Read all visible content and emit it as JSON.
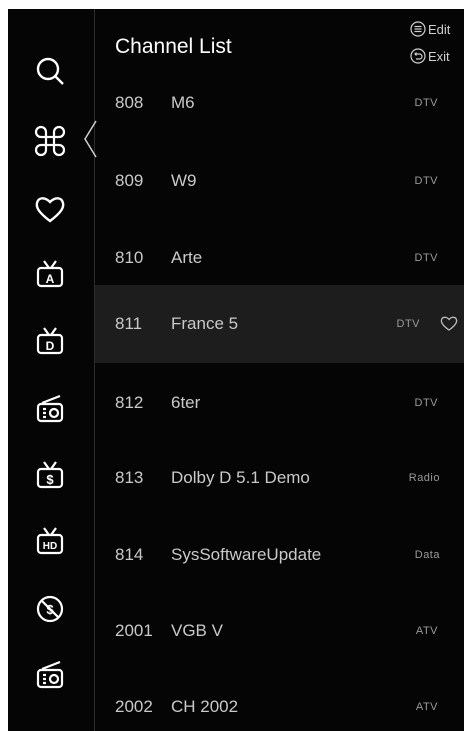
{
  "header": {
    "title": "Channel List",
    "edit_label": "Edit",
    "exit_label": "Exit"
  },
  "sidebar": {
    "items": [
      {
        "icon": "search-icon"
      },
      {
        "icon": "all-channels-icon",
        "active": true
      },
      {
        "icon": "favorites-icon"
      },
      {
        "icon": "tv-antenna-icon"
      },
      {
        "icon": "dtv-icon"
      },
      {
        "icon": "radio-icon"
      },
      {
        "icon": "paid-channel-icon"
      },
      {
        "icon": "hd-channel-icon"
      },
      {
        "icon": "free-channel-icon"
      },
      {
        "icon": "radio-icon"
      }
    ]
  },
  "channels": [
    {
      "number": "808",
      "name": "M6",
      "type": "DTV"
    },
    {
      "number": "809",
      "name": "W9",
      "type": "DTV"
    },
    {
      "number": "810",
      "name": "Arte",
      "type": "DTV"
    },
    {
      "number": "811",
      "name": "France 5",
      "type": "DTV",
      "selected": true,
      "favorite": true
    },
    {
      "number": "812",
      "name": "6ter",
      "type": "DTV"
    },
    {
      "number": "813",
      "name": "Dolby D 5.1 Demo",
      "type": "Radio"
    },
    {
      "number": "814",
      "name": "SysSoftwareUpdate",
      "type": "Data"
    },
    {
      "number": "2001",
      "name": "VGB V",
      "type": "ATV"
    },
    {
      "number": "2002",
      "name": "CH 2002",
      "type": "ATV"
    }
  ],
  "colors": {
    "background": "#050505",
    "selected_row": "#1d1d1d",
    "text": "#c9c9c9"
  }
}
